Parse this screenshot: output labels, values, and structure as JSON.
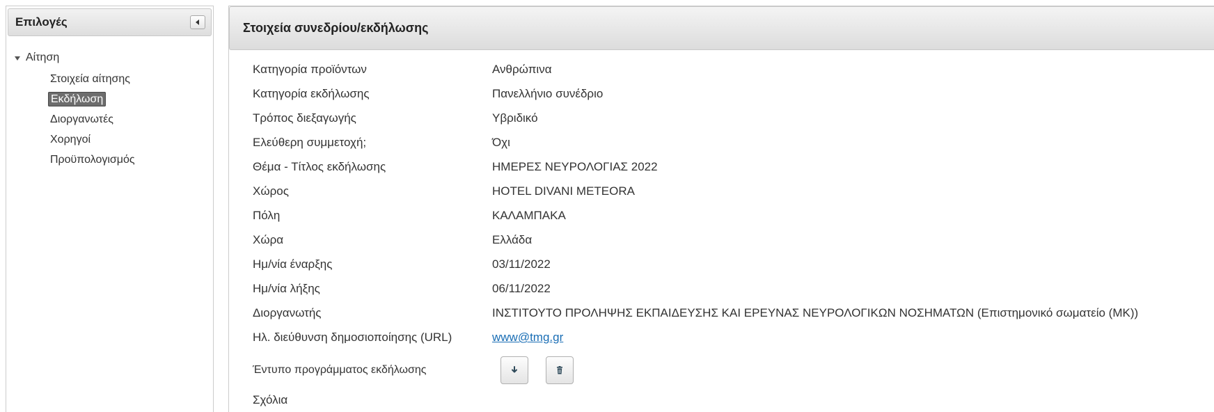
{
  "sidebar": {
    "title": "Επιλογές",
    "tree_root": "Αίτηση",
    "items": [
      {
        "label": "Στοιχεία αίτησης",
        "selected": false
      },
      {
        "label": "Εκδήλωση",
        "selected": true
      },
      {
        "label": "Διοργανωτές",
        "selected": false
      },
      {
        "label": "Χορηγοί",
        "selected": false
      },
      {
        "label": "Προϋπολογισμός",
        "selected": false
      }
    ]
  },
  "main": {
    "title": "Στοιχεία συνεδρίου/εκδήλωσης",
    "fields": [
      {
        "label": "Κατηγορία προϊόντων",
        "value": "Ανθρώπινα"
      },
      {
        "label": "Κατηγορία εκδήλωσης",
        "value": "Πανελλήνιο συνέδριο"
      },
      {
        "label": "Τρόπος διεξαγωγής",
        "value": "Υβριδικό"
      },
      {
        "label": "Ελεύθερη συμμετοχή;",
        "value": "Όχι"
      },
      {
        "label": "Θέμα - Τίτλος εκδήλωσης",
        "value": "ΗΜΕΡΕΣ ΝΕΥΡΟΛΟΓΙΑΣ 2022"
      },
      {
        "label": "Χώρος",
        "value": "HOTEL DIVANI METEORA"
      },
      {
        "label": "Πόλη",
        "value": "ΚΑΛΑΜΠΑΚΑ"
      },
      {
        "label": "Χώρα",
        "value": "Ελλάδα"
      },
      {
        "label": "Ημ/νία έναρξης",
        "value": "03/11/2022"
      },
      {
        "label": "Ημ/νία λήξης",
        "value": "06/11/2022"
      },
      {
        "label": "Διοργανωτής",
        "value": "ΙΝΣΤΙΤΟΥΤΟ ΠΡΟΛΗΨΗΣ ΕΚΠΑΙΔΕΥΣΗΣ ΚΑΙ ΕΡΕΥΝΑΣ ΝΕΥΡΟΛΟΓΙΚΩΝ ΝΟΣΗΜΑΤΩΝ (Επιστημονικό σωματείο (ΜΚ))"
      }
    ],
    "url_field": {
      "label": "Ηλ. διεύθυνση δημοσιοποίησης (URL)",
      "value": "www@tmg.gr"
    },
    "program_field": {
      "label": "Έντυπο προγράμματος εκδήλωσης",
      "download_icon": "download-icon",
      "delete_icon": "trash-icon"
    },
    "comments_label": "Σχόλια"
  },
  "colors": {
    "link": "#1a6eb5",
    "selected_bg": "#6d6d6d",
    "header_gradient_top": "#f4f4f4",
    "header_gradient_bottom": "#dcdcdc"
  }
}
